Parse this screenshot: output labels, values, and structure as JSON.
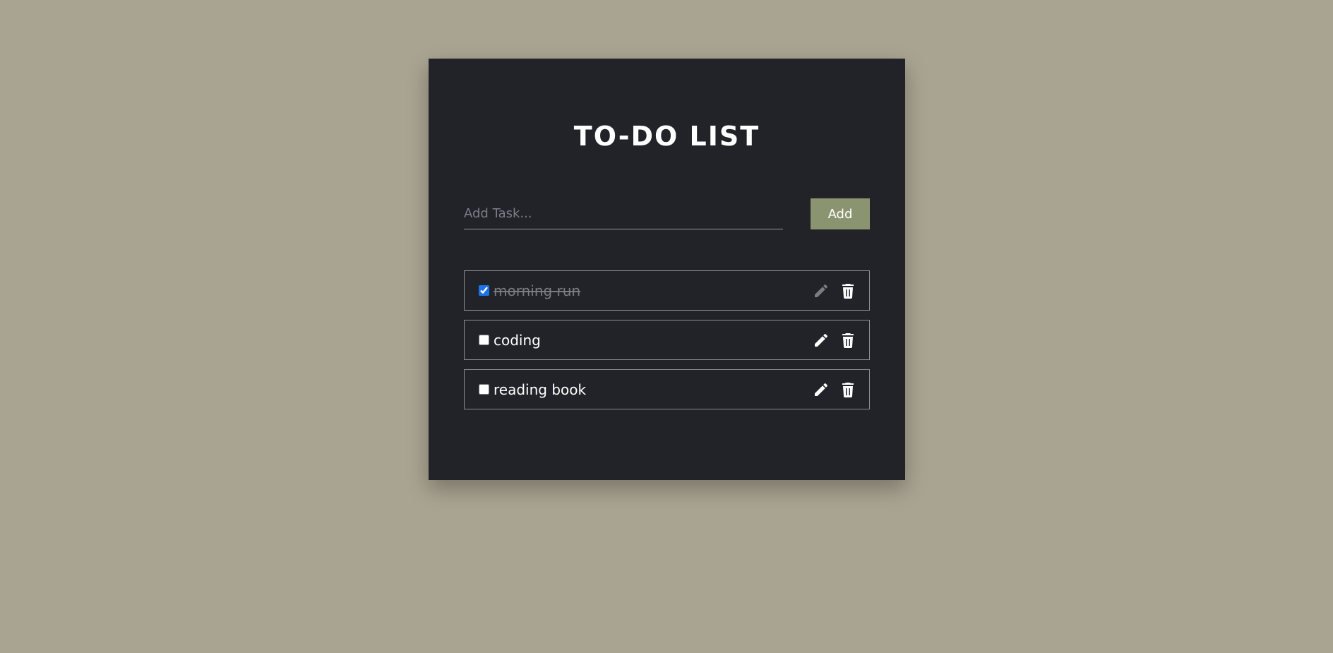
{
  "app": {
    "title": "TO-DO LIST"
  },
  "add_task": {
    "placeholder": "Add Task...",
    "value": "",
    "button_label": "Add"
  },
  "tasks": [
    {
      "label": "morning run",
      "completed": true
    },
    {
      "label": "coding",
      "completed": false
    },
    {
      "label": "reading book",
      "completed": false
    }
  ],
  "icons": {
    "edit": "pencil-icon",
    "delete": "trash-icon"
  },
  "colors": {
    "background": "#a9a391",
    "card": "#212329",
    "accent": "#8b9470",
    "checkbox": "#1a73e8",
    "completed_text": "#7a7c82"
  }
}
